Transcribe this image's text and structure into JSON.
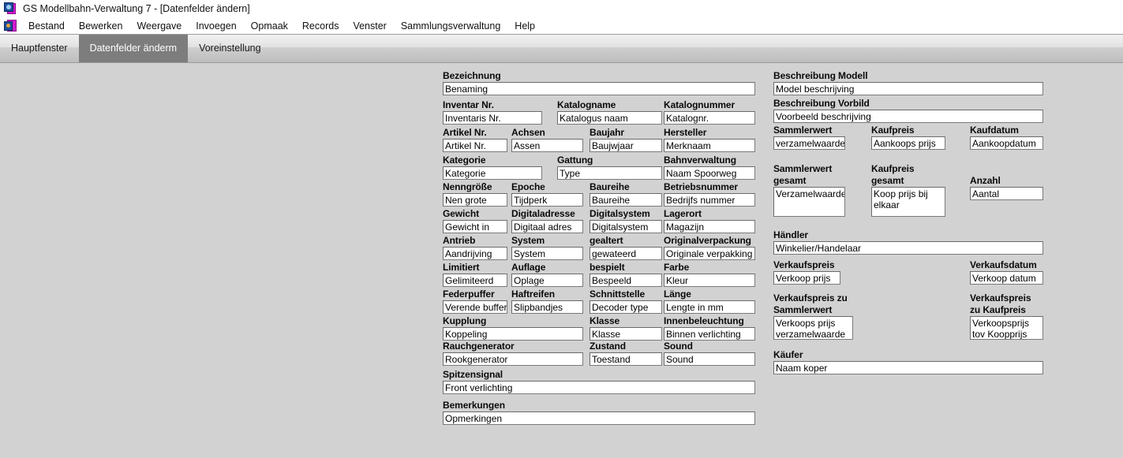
{
  "window": {
    "title": "GS Modellbahn-Verwaltung 7 - [Datenfelder ändern]",
    "app_icon": "app-icon"
  },
  "menubar": {
    "icon": "app-menu-icon",
    "items": [
      {
        "label": "Bestand"
      },
      {
        "label": "Bewerken"
      },
      {
        "label": "Weergave"
      },
      {
        "label": "Invoegen"
      },
      {
        "label": "Opmaak"
      },
      {
        "label": "Records"
      },
      {
        "label": "Venster"
      },
      {
        "label": "Sammlungsverwaltung"
      },
      {
        "label": "Help"
      }
    ]
  },
  "tabs": [
    {
      "label": "Hauptfenster",
      "active": false
    },
    {
      "label": "Datenfelder änderm",
      "active": true
    },
    {
      "label": "Voreinstellung",
      "active": false
    }
  ],
  "colors": {
    "background": "#d2d2d2",
    "active_tab": "#7d7d7d",
    "field_border": "#7a7a7a",
    "field_bg": "#ffffff"
  },
  "form": {
    "left_column": [
      {
        "label": "Bezeichnung",
        "value": "Benaming"
      },
      {
        "label": "Inventar Nr.",
        "value": "Inventaris Nr."
      },
      {
        "label": "Katalogname",
        "value": "Katalogus naam"
      },
      {
        "label": "Katalognummer",
        "value": "Katalognr."
      },
      {
        "label": "Artikel Nr.",
        "value": "Artikel Nr."
      },
      {
        "label": "Achsen",
        "value": "Assen"
      },
      {
        "label": "Baujahr",
        "value": "Baujwjaar"
      },
      {
        "label": "Hersteller",
        "value": "Merknaam"
      },
      {
        "label": "Kategorie",
        "value": "Kategorie"
      },
      {
        "label": "Gattung",
        "value": "Type"
      },
      {
        "label": "Bahnverwaltung",
        "value": "Naam Spoorweg"
      },
      {
        "label": "Nenngröße",
        "value": "Nen grote"
      },
      {
        "label": "Epoche",
        "value": "Tijdperk"
      },
      {
        "label": "Baureihe",
        "value": "Baureihe"
      },
      {
        "label": "Betriebsnummer",
        "value": "Bedrijfs nummer"
      },
      {
        "label": "Gewicht",
        "value": "Gewicht in"
      },
      {
        "label": "Digitaladresse",
        "value": "Digitaal adres"
      },
      {
        "label": "Digitalsystem",
        "value": "Digitalsystem"
      },
      {
        "label": "Lagerort",
        "value": "Magazijn"
      },
      {
        "label": "Antrieb",
        "value": "Aandrijving"
      },
      {
        "label": "System",
        "value": "System"
      },
      {
        "label": "gealtert",
        "value": "gewateerd"
      },
      {
        "label": "Originalverpackung",
        "value": "Originale verpakking"
      },
      {
        "label": "Limitiert",
        "value": "Gelimiteerd"
      },
      {
        "label": "Auflage",
        "value": "Oplage"
      },
      {
        "label": "bespielt",
        "value": "Bespeeld"
      },
      {
        "label": "Farbe",
        "value": "Kleur"
      },
      {
        "label": "Federpuffer",
        "value": "Verende buffer"
      },
      {
        "label": "Haftreifen",
        "value": "Slipbandjes"
      },
      {
        "label": "Schnittstelle",
        "value": "Decoder type"
      },
      {
        "label": "Länge",
        "value": "Lengte in mm"
      },
      {
        "label": "Kupplung",
        "value": "Koppeling"
      },
      {
        "label": "Klasse",
        "value": "Klasse"
      },
      {
        "label": "Innenbeleuchtung",
        "value": "Binnen verlichting"
      },
      {
        "label": "Rauchgenerator",
        "value": "Rookgenerator"
      },
      {
        "label": "Zustand",
        "value": "Toestand"
      },
      {
        "label": "Sound",
        "value": "Sound"
      },
      {
        "label": "Spitzensignal",
        "value": "Front verlichting"
      },
      {
        "label": "Bemerkungen",
        "value": "Opmerkingen"
      }
    ],
    "right_column": [
      {
        "label": "Beschreibung Modell",
        "value": "Model beschrijving"
      },
      {
        "label": "Beschreibung Vorbild",
        "value": "Voorbeeld beschrijving"
      },
      {
        "label": "Sammlerwert",
        "value": "verzamelwaarde"
      },
      {
        "label": "Kaufpreis",
        "value": "Aankoops prijs"
      },
      {
        "label": "Kaufdatum",
        "value": "Aankoopdatum"
      },
      {
        "label": "Sammlerwert gesamt",
        "value": "Verzamelwaarde"
      },
      {
        "label": "Kaufpreis gesamt",
        "value": "Koop prijs bij elkaar"
      },
      {
        "label": "Anzahl",
        "value": "Aantal"
      },
      {
        "label": "Händler",
        "value": "Winkelier/Handelaar"
      },
      {
        "label": "Verkaufspreis",
        "value": "Verkoop prijs"
      },
      {
        "label": "Verkaufsdatum",
        "value": "Verkoop datum"
      },
      {
        "label": "Verkaufspreis zu Sammlerwert",
        "value": "Verkoops prijs verzamelwaarde"
      },
      {
        "label": "Verkaufspreis zu Kaufpreis",
        "value": "Verkoopsprijs tov Koopprijs"
      },
      {
        "label": "Käufer",
        "value": "Naam koper"
      }
    ],
    "right_multiline_labels": {
      "sammlerwert_gesamt_l1": "Sammlerwert",
      "sammlerwert_gesamt_l2": "gesamt",
      "kaufpreis_gesamt_l1": "Kaufpreis",
      "kaufpreis_gesamt_l2": "gesamt",
      "vk_sammlerwert_l1": "Verkaufspreis zu",
      "vk_sammlerwert_l2": "Sammlerwert",
      "vk_kaufpreis_l1": "Verkaufspreis",
      "vk_kaufpreis_l2": "zu Kaufpreis"
    }
  }
}
